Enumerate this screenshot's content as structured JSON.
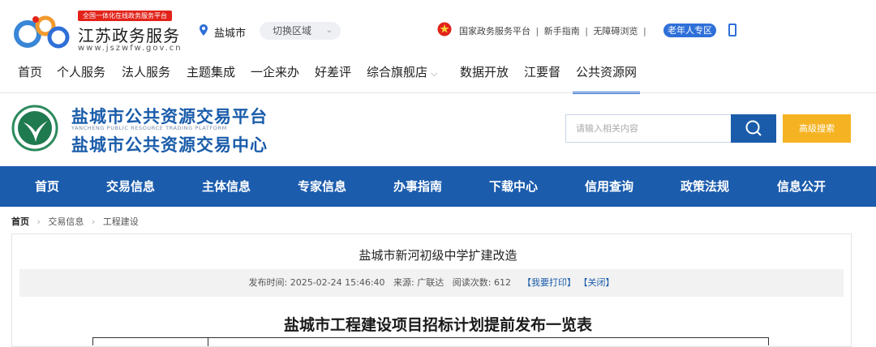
{
  "gov": {
    "slogan": "全国一体化在线政务服务平台",
    "name": "江苏政务服务",
    "url": "www.jszwfw.gov.cn",
    "city": "盐城市",
    "switch_label": "切换区域",
    "links": [
      "国家政务服务平台",
      "新手指南",
      "无障碍浏览"
    ],
    "elder_label": "老年人专区",
    "nav": [
      "首页",
      "个人服务",
      "法人服务",
      "主题集成",
      "一企来办",
      "好差评",
      "综合旗舰店",
      "数据开放",
      "江要督",
      "公共资源网"
    ],
    "active_nav": "公共资源网"
  },
  "platform": {
    "title1": "盐城市公共资源交易平台",
    "title_en": "YANCHENG PUBLIC RESOURCE TRADING PLATFORM",
    "title2": "盐城市公共资源交易中心",
    "search_placeholder": "请输入相关内容",
    "advanced_search": "高级搜索",
    "nav": [
      "首页",
      "交易信息",
      "主体信息",
      "专家信息",
      "办事指南",
      "下载中心",
      "信用查询",
      "政策法规",
      "信息公开"
    ]
  },
  "breadcrumb": [
    "首页",
    "交易信息",
    "工程建设"
  ],
  "article": {
    "title": "盐城市新河初级中学扩建改造",
    "publish_label": "发布时间:",
    "publish_time": "2025-02-24 15:46:40",
    "source_label": "来源:",
    "source": "广联达",
    "views_label": "阅读次数:",
    "views": "612",
    "print": "【我要打印】",
    "close": "【关闭】",
    "heading": "盐城市工程建设项目招标计划提前发布一览表"
  },
  "colors": {
    "primary": "#1b5cad",
    "accent": "#f5b324",
    "gov_blue": "#2f6fd8",
    "red": "#e2231a"
  }
}
